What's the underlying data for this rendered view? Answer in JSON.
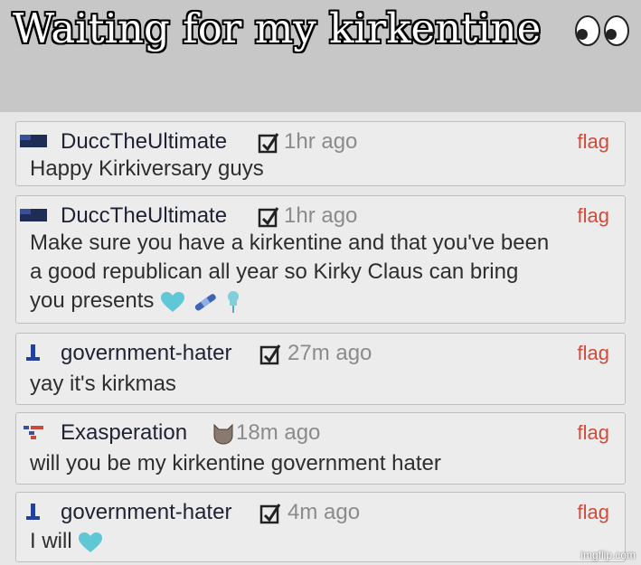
{
  "caption": "Waiting for my kirkentine",
  "comments": [
    {
      "user": "DuccTheUltimate",
      "time": "1hr ago",
      "flag": "flag",
      "text": "Happy Kirkiversary guys"
    },
    {
      "user": "DuccTheUltimate",
      "time": "1hr ago",
      "flag": "flag",
      "text_line1": "Make sure you have a kirkentine and that you've been",
      "text_line2": "a good republican all year so Kirky Claus can bring",
      "text_line3": "you presents"
    },
    {
      "user": "government-hater",
      "time": "27m ago",
      "flag": "flag",
      "text": "yay it's kirkmas"
    },
    {
      "user": "Exasperation",
      "time": "18m ago",
      "flag": "flag",
      "text": "will you be my kirkentine government hater"
    },
    {
      "user": "government-hater",
      "time": "4m ago",
      "flag": "flag",
      "text": "I will"
    }
  ],
  "watermark": "imgflip.com",
  "icons": [
    "eyes-emoji-icon",
    "checkbox-badge-icon",
    "blue-heart-icon",
    "bandage-icon",
    "pushpin-icon",
    "cat-mask-badge-icon"
  ],
  "colors": {
    "flag": "#d24a3a",
    "username": "#1e2233",
    "time": "#8b8b8b",
    "heart": "#5fc7d6"
  }
}
